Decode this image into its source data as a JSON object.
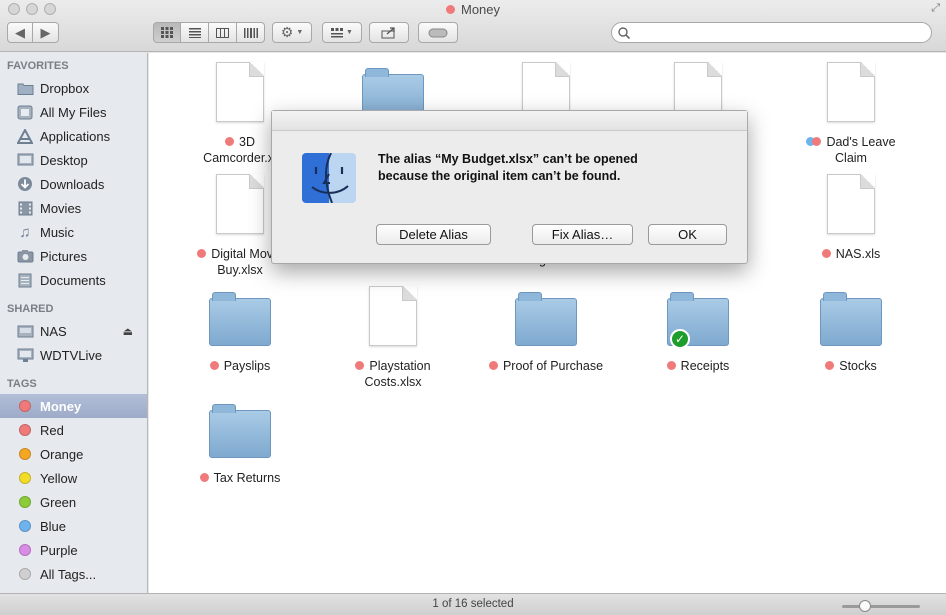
{
  "window": {
    "title": "Money",
    "tag_color": "#f07a7a"
  },
  "toolbar": {
    "back_icon": "back-arrow-icon",
    "forward_icon": "forward-arrow-icon",
    "view_icons": [
      "icon-view-icon",
      "list-view-icon",
      "column-view-icon",
      "cover-flow-icon"
    ],
    "action_icon": "gear-icon",
    "arrange_icon": "arrange-icon",
    "share_icon": "share-icon",
    "tags_icon": "tag-icon",
    "search_placeholder": ""
  },
  "sidebar": {
    "favorites_header": "FAVORITES",
    "favorites": [
      {
        "label": "Dropbox",
        "icon": "folder-icon"
      },
      {
        "label": "All My Files",
        "icon": "all-files-icon"
      },
      {
        "label": "Applications",
        "icon": "applications-icon"
      },
      {
        "label": "Desktop",
        "icon": "desktop-icon"
      },
      {
        "label": "Downloads",
        "icon": "downloads-icon"
      },
      {
        "label": "Movies",
        "icon": "movies-icon"
      },
      {
        "label": "Music",
        "icon": "music-icon"
      },
      {
        "label": "Pictures",
        "icon": "camera-icon"
      },
      {
        "label": "Documents",
        "icon": "documents-icon"
      }
    ],
    "shared_header": "SHARED",
    "shared": [
      {
        "label": "NAS",
        "icon": "network-drive-icon"
      },
      {
        "label": "WDTVLive",
        "icon": "monitor-icon"
      }
    ],
    "tags_header": "TAGS",
    "tags": [
      {
        "label": "Money",
        "color": "#f07a7a"
      },
      {
        "label": "Red",
        "color": "#f07a7a"
      },
      {
        "label": "Orange",
        "color": "#f5a623"
      },
      {
        "label": "Yellow",
        "color": "#f2dc2a"
      },
      {
        "label": "Green",
        "color": "#8ccc3a"
      },
      {
        "label": "Blue",
        "color": "#6fb3ee"
      },
      {
        "label": "Purple",
        "color": "#d98ce6"
      },
      {
        "label": "All Tags...",
        "color": "#d0d0d0"
      }
    ]
  },
  "files": [
    {
      "line1": "3D",
      "line2": "Camcorder.xl",
      "kind": "doc"
    },
    {
      "line1": "",
      "line2": "",
      "kind": "folder"
    },
    {
      "line1": "",
      "line2": "",
      "kind": "doc"
    },
    {
      "line1": "",
      "line2": "",
      "kind": "doc"
    },
    {
      "line1": "Dad's Leave",
      "line2": "Claim",
      "kind": "doc"
    },
    {
      "line1": "Digital Movie",
      "line2": "Buy.xlsx",
      "kind": "doc"
    },
    {
      "line1": "",
      "line2": "Budget.xls",
      "kind": "hidden"
    },
    {
      "line1": "NAS.xls",
      "line2": "",
      "kind": "doc"
    },
    {
      "line1": "Payslips",
      "line2": "",
      "kind": "folder"
    },
    {
      "line1": "Playstation",
      "line2": "Costs.xlsx",
      "kind": "doc"
    },
    {
      "line1": "Proof of Purchase",
      "line2": "",
      "kind": "folder"
    },
    {
      "line1": "Receipts",
      "line2": "",
      "kind": "folder"
    },
    {
      "line1": "Stocks",
      "line2": "",
      "kind": "folder"
    },
    {
      "line1": "Tax Returns",
      "line2": "",
      "kind": "folder"
    }
  ],
  "status": {
    "text": "1 of 16 selected",
    "zoom_fraction": 0.25
  },
  "dialog": {
    "message_line1": "The alias “My Budget.xlsx” can’t be opened",
    "message_line2": "because the original item can’t be found.",
    "delete_label": "Delete Alias",
    "fix_label": "Fix Alias…",
    "ok_label": "OK",
    "icon": "finder-icon"
  }
}
